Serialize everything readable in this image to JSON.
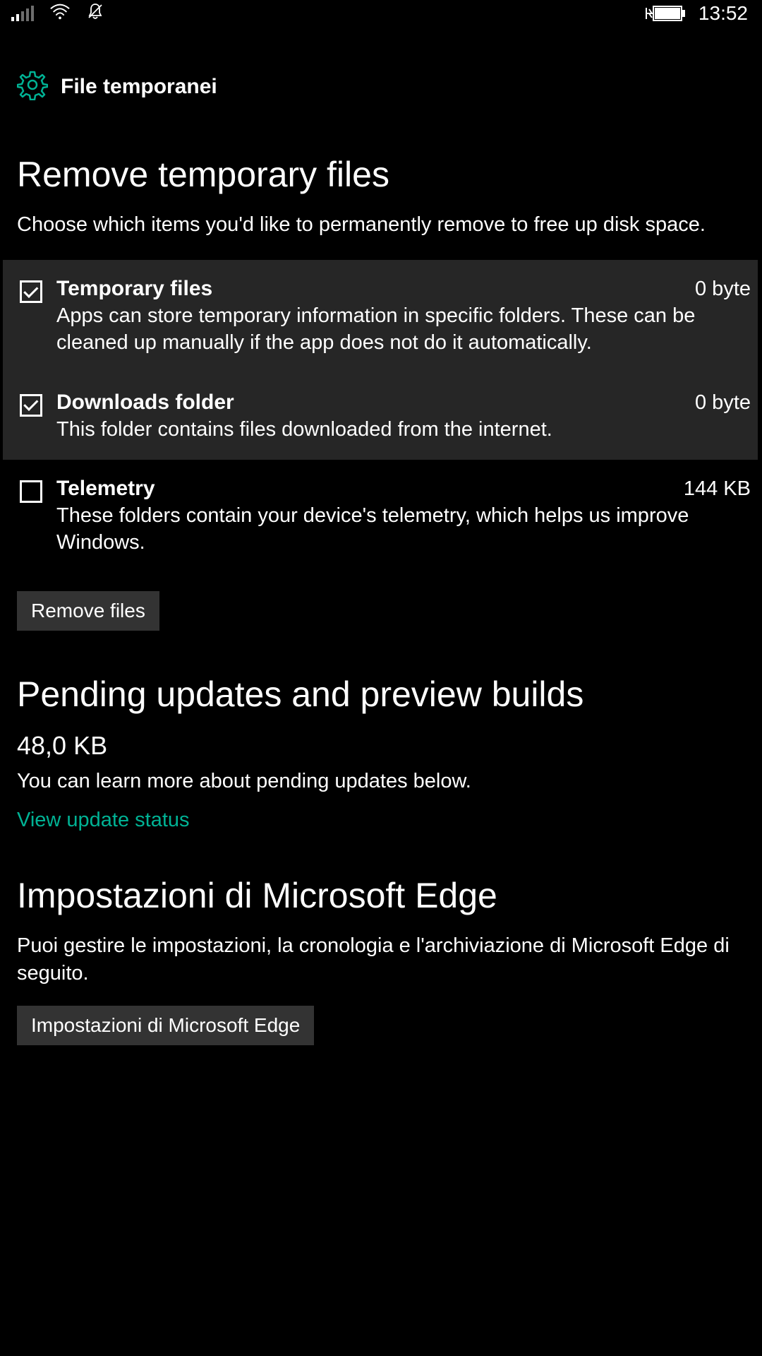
{
  "status_bar": {
    "time": "13:52"
  },
  "header": {
    "title": "File temporanei",
    "accent_color": "#00b294"
  },
  "main": {
    "section_title": "Remove temporary files",
    "section_desc": "Choose which items you'd like to permanently remove to free up disk space.",
    "items": [
      {
        "title": "Temporary files",
        "size": "0 byte",
        "desc": "Apps can store temporary information in specific folders. These can be cleaned up manually if the app does not do it automatically.",
        "checked": true
      },
      {
        "title": "Downloads folder",
        "size": "0 byte",
        "desc": "This folder contains files downloaded from the internet.",
        "checked": true
      },
      {
        "title": "Telemetry",
        "size": "144 KB",
        "desc": "These folders contain your device's telemetry, which helps us improve Windows.",
        "checked": false
      }
    ],
    "remove_button_label": "Remove files"
  },
  "pending": {
    "title": "Pending updates and preview builds",
    "size": "48,0 KB",
    "desc": "You can learn more about pending updates below.",
    "link_label": "View update status"
  },
  "edge": {
    "title": "Impostazioni di Microsoft Edge",
    "desc": "Puoi gestire le impostazioni, la cronologia e l'archiviazione di Microsoft Edge di seguito.",
    "button_label": "Impostazioni di Microsoft Edge"
  }
}
